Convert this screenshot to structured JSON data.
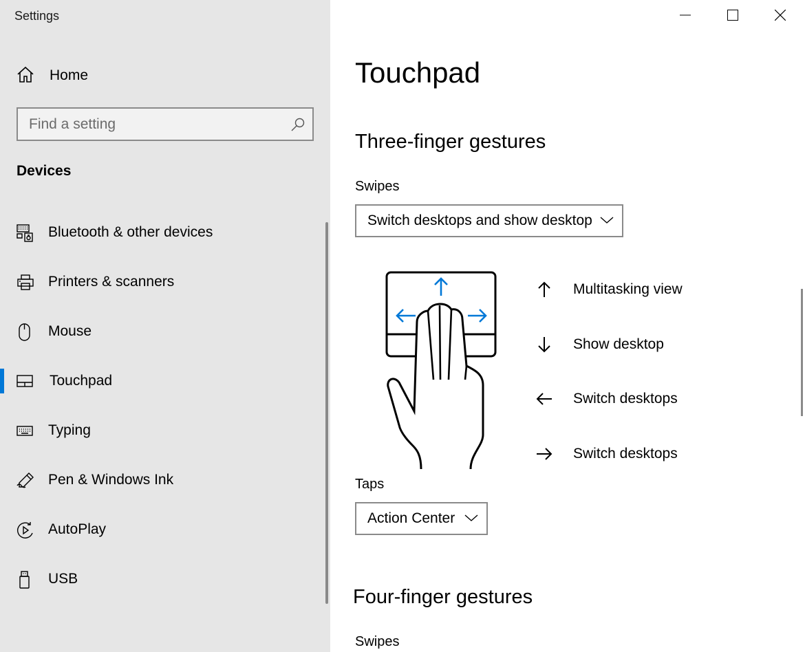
{
  "window": {
    "title": "Settings",
    "controls": {
      "minimize": "minimize-icon",
      "maximize": "maximize-icon",
      "close": "close-icon"
    }
  },
  "sidebar": {
    "home_label": "Home",
    "search_placeholder": "Find a setting",
    "section": "Devices",
    "items": [
      {
        "label": "Bluetooth & other devices",
        "icon": "bluetooth-devices-icon"
      },
      {
        "label": "Printers & scanners",
        "icon": "printer-icon"
      },
      {
        "label": "Mouse",
        "icon": "mouse-icon"
      },
      {
        "label": "Touchpad",
        "icon": "touchpad-icon",
        "active": true
      },
      {
        "label": "Typing",
        "icon": "keyboard-icon"
      },
      {
        "label": "Pen & Windows Ink",
        "icon": "pen-icon"
      },
      {
        "label": "AutoPlay",
        "icon": "autoplay-icon"
      },
      {
        "label": "USB",
        "icon": "usb-icon"
      }
    ]
  },
  "main": {
    "title": "Touchpad",
    "three_finger": {
      "heading": "Three-finger gestures",
      "swipes_label": "Swipes",
      "swipes_value": "Switch desktops and show desktop",
      "gestures": [
        {
          "direction": "up",
          "label": "Multitasking view"
        },
        {
          "direction": "down",
          "label": "Show desktop"
        },
        {
          "direction": "left",
          "label": "Switch desktops"
        },
        {
          "direction": "right",
          "label": "Switch desktops"
        }
      ],
      "taps_label": "Taps",
      "taps_value": "Action Center"
    },
    "four_finger": {
      "heading": "Four-finger gestures",
      "swipes_label": "Swipes"
    }
  },
  "colors": {
    "accent": "#0078d7",
    "sidebar_bg": "#e6e6e6",
    "border": "#8a8a8a"
  }
}
